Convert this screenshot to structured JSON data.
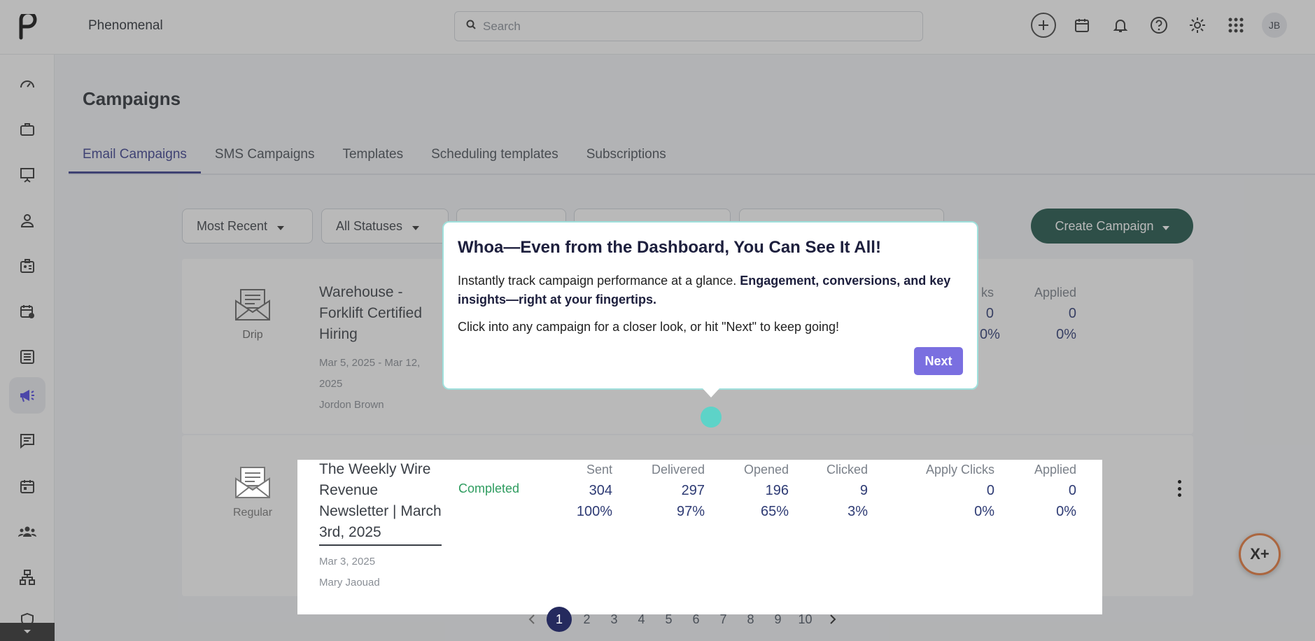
{
  "header": {
    "brand": "Phenomenal",
    "search_placeholder": "Search",
    "avatar_initials": "JB",
    "icons": [
      "plus-icon",
      "calendar-icon",
      "bell-icon",
      "help-icon",
      "gear-icon",
      "apps-grid-icon"
    ]
  },
  "sidebar": {
    "items": [
      "dashboard-icon",
      "briefcase-icon",
      "presentation-icon",
      "person-icon",
      "id-card-icon",
      "calendar-clock-icon",
      "list-icon",
      "megaphone-icon",
      "chat-icon",
      "calendar-icon",
      "group-icon",
      "org-chart-icon",
      "shield-icon"
    ],
    "active": "megaphone-icon"
  },
  "page": {
    "title": "Campaigns",
    "tabs": [
      "Email Campaigns",
      "SMS Campaigns",
      "Templates",
      "Scheduling templates",
      "Subscriptions"
    ],
    "active_tab": "Email Campaigns"
  },
  "filters": {
    "sort": "Most Recent",
    "status": "All Statuses",
    "create_label": "Create Campaign"
  },
  "campaigns": [
    {
      "type": "Drip",
      "title_lines": [
        "Warehouse -",
        "Forklift Certified",
        "Hiring"
      ],
      "dates_lines": [
        "Mar 5, 2025 - Mar 12,",
        "2025"
      ],
      "owner": "Jordon Brown",
      "stats": {
        "apply_clicks_header": "ks",
        "applied_header": "Applied",
        "apply_clicks": "0",
        "apply_clicks_pct": "0%",
        "applied": "0",
        "applied_pct": "0%"
      }
    },
    {
      "type": "Regular",
      "title_lines": [
        "The Weekly Wire",
        "Revenue",
        "Newsletter | March",
        "3rd, 2025"
      ],
      "date": "Mar 3, 2025",
      "owner": "Mary Jaouad",
      "status": "Completed",
      "stats": [
        {
          "label": "Sent",
          "value": "304",
          "pct": "100%"
        },
        {
          "label": "Delivered",
          "value": "297",
          "pct": "97%"
        },
        {
          "label": "Opened",
          "value": "196",
          "pct": "65%"
        },
        {
          "label": "Clicked",
          "value": "9",
          "pct": "3%"
        },
        {
          "label": "Apply Clicks",
          "value": "0",
          "pct": "0%"
        },
        {
          "label": "Applied",
          "value": "0",
          "pct": "0%"
        }
      ]
    }
  ],
  "pagination": {
    "pages": [
      "1",
      "2",
      "3",
      "4",
      "5",
      "6",
      "7",
      "8",
      "9",
      "10"
    ],
    "current": "1"
  },
  "tour": {
    "title": "Whoa—Even from the Dashboard, You Can See It All!",
    "line1_plain": "Instantly track campaign performance at a glance. ",
    "line1_bold": "Engagement, conversions, and key insights—right at your fingertips.",
    "line2": "Click into any campaign for a closer look, or hit \"Next\" to keep going!",
    "next_label": "Next"
  },
  "fab_label": "X+",
  "colors": {
    "primary_dark": "#1f5449",
    "accent": "#7a6fe0",
    "tab_active": "#3b3f8f",
    "status_completed": "#2e9c5f",
    "beacon": "#5dd3c8"
  }
}
